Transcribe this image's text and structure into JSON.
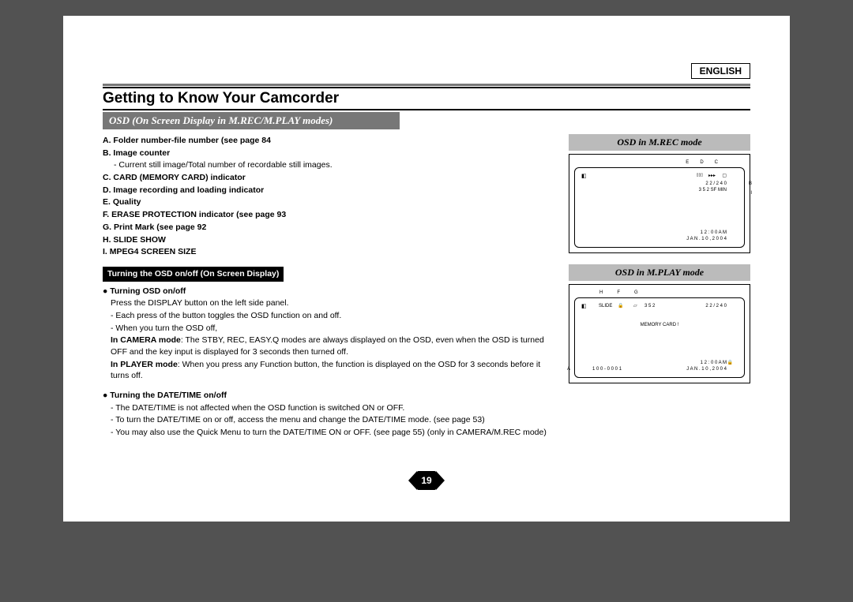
{
  "header": {
    "language": "ENGLISH",
    "title": "Getting to Know Your Camcorder"
  },
  "section_bar": "OSD (On Screen Display in M.REC/M.PLAY modes)",
  "definitions": {
    "A": "A. Folder number-file number (see page 84",
    "B": "B. Image counter",
    "B_sub": "- Current still image/Total number of recordable still images.",
    "C": "C. CARD (MEMORY CARD) indicator",
    "D": "D. Image recording and loading indicator",
    "E": "E. Quality",
    "F": "F. ERASE PROTECTION indicator (see page 93",
    "G": "G. Print Mark (see page 92",
    "H": "H. SLIDE SHOW",
    "I": "I.  MPEG4 SCREEN SIZE"
  },
  "pill": "Turning the OSD on/off (On Screen Display)",
  "turning_osd": {
    "heading": "● Turning OSD on/off",
    "line1": "Press the DISPLAY button on the left side panel.",
    "line2": "- Each press of the button toggles the OSD function on and off.",
    "line3": "- When you turn the OSD off,",
    "line4a": "In CAMERA mode",
    "line4b": ": The STBY, REC, EASY.Q modes are always displayed on the OSD, even when the OSD is turned OFF and the key input is displayed for 3 seconds then turned off.",
    "line5a": "In PLAYER mode",
    "line5b": ": When you press any Function button, the function is displayed on the OSD for 3 seconds before it turns off."
  },
  "turning_date": {
    "heading": "● Turning the DATE/TIME on/off",
    "line1": "- The DATE/TIME is not affected when the OSD function is switched ON or OFF.",
    "line2": "- To turn the DATE/TIME on or off, access the menu and change the DATE/TIME mode. (see page 53)",
    "line3": "- You may also use the Quick Menu to turn the DATE/TIME ON or OFF. (see page 55) (only in CAMERA/M.REC mode)"
  },
  "fig1": {
    "title": "OSD in M.REC mode",
    "labels": {
      "E": "E",
      "D": "D",
      "C": "C",
      "B": "B",
      "I": "I"
    },
    "text": {
      "counter": "2 2 / 2 4 0",
      "size": "3 5 2  SF  MIN",
      "time": "1 2 : 0 0 A M",
      "date": "J A N . 1 0 , 2 0 0 4"
    }
  },
  "fig2": {
    "title": "OSD in M.PLAY mode",
    "labels": {
      "H": "H",
      "F": "F",
      "G": "G",
      "A": "A"
    },
    "text": {
      "slide": "SLIDE",
      "size": "3 5 2",
      "counter": "2 2 / 2 4 0",
      "card": "MEMORY CARD !",
      "folder": "1 0 0 - 0 0 0 1",
      "time": "1 2 : 0 0 A M",
      "date": "J A N . 1 0 , 2 0 0 4"
    }
  },
  "page_number": "19"
}
